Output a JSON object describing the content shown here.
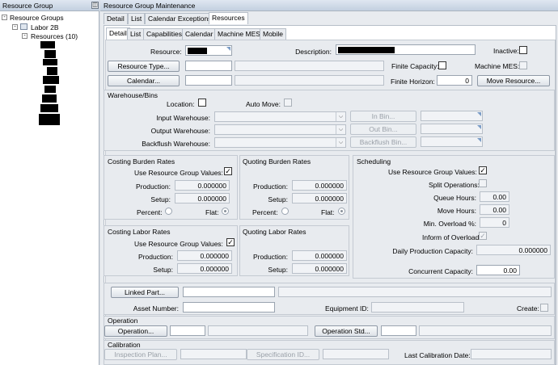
{
  "left_panel": {
    "title": "Resource Group",
    "tree": {
      "root": "Resource Groups",
      "group": "Labor 2B",
      "resources": "Resources (10)"
    }
  },
  "window": {
    "title": "Resource Group Maintenance"
  },
  "tabs_top": [
    "Detail",
    "List",
    "Calendar Exceptions",
    "Resources"
  ],
  "tabs_sub": [
    "Detail",
    "List",
    "Capabilities",
    "Calendar",
    "Machine MES",
    "Mobile"
  ],
  "form": {
    "resource_label": "Resource:",
    "description_label": "Description:",
    "inactive_label": "Inactive:",
    "resource_type_button": "Resource Type...",
    "finite_capacity_label": "Finite Capacity:",
    "machine_mes_label": "Machine MES:",
    "calendar_button": "Calendar...",
    "finite_horizon_label": "Finite Horizon:",
    "finite_horizon_value": "0",
    "move_resource_button": "Move Resource..."
  },
  "warehouse": {
    "title": "Warehouse/Bins",
    "location_label": "Location:",
    "auto_move_label": "Auto Move:",
    "input_label": "Input Warehouse:",
    "output_label": "Output Warehouse:",
    "backflush_label": "Backflush Warehouse:",
    "in_bin": "In Bin...",
    "out_bin": "Out Bin...",
    "backflush_bin": "Backflush Bin..."
  },
  "costing_burden": {
    "title": "Costing Burden Rates",
    "use_group": "Use Resource Group Values:",
    "production_label": "Production:",
    "production_value": "0.000000",
    "setup_label": "Setup:",
    "setup_value": "0.000000",
    "percent_label": "Percent:",
    "flat_label": "Flat:"
  },
  "quoting_burden": {
    "title": "Quoting Burden Rates",
    "production_label": "Production:",
    "production_value": "0.000000",
    "setup_label": "Setup:",
    "setup_value": "0.000000",
    "percent_label": "Percent:",
    "flat_label": "Flat:"
  },
  "scheduling": {
    "title": "Scheduling",
    "use_group": "Use Resource Group Values:",
    "split_ops": "Split Operations:",
    "queue_hours_label": "Queue Hours:",
    "queue_hours_value": "0.00",
    "move_hours_label": "Move Hours:",
    "move_hours_value": "0.00",
    "min_overload_label": "Min. Overload %:",
    "min_overload_value": "0",
    "inform_overload": "Inform of Overload:",
    "daily_capacity_label": "Daily Production Capacity:",
    "daily_capacity_value": "0.000000",
    "concurrent_label": "Concurrent Capacity:",
    "concurrent_value": "0.00"
  },
  "costing_labor": {
    "title": "Costing Labor Rates",
    "use_group": "Use Resource Group Values:",
    "production_label": "Production:",
    "production_value": "0.000000",
    "setup_label": "Setup:",
    "setup_value": "0.000000"
  },
  "quoting_labor": {
    "title": "Quoting Labor Rates",
    "production_label": "Production:",
    "production_value": "0.000000",
    "setup_label": "Setup:",
    "setup_value": "0.000000"
  },
  "bottom": {
    "linked_part_button": "Linked Part...",
    "asset_number_label": "Asset Number:",
    "equipment_id_label": "Equipment ID:",
    "create_label": "Create:",
    "operation_title": "Operation",
    "operation_button": "Operation...",
    "operation_std_button": "Operation Std...",
    "calibration_title": "Calibration",
    "inspection_plan_button": "Inspection Plan...",
    "specification_id_button": "Specification ID...",
    "last_calibration_label": "Last Calibration Date:"
  },
  "colors": {
    "title_bar": "#c8d4e3",
    "panel_bg": "#e8ebef",
    "check_color": "#333333"
  }
}
